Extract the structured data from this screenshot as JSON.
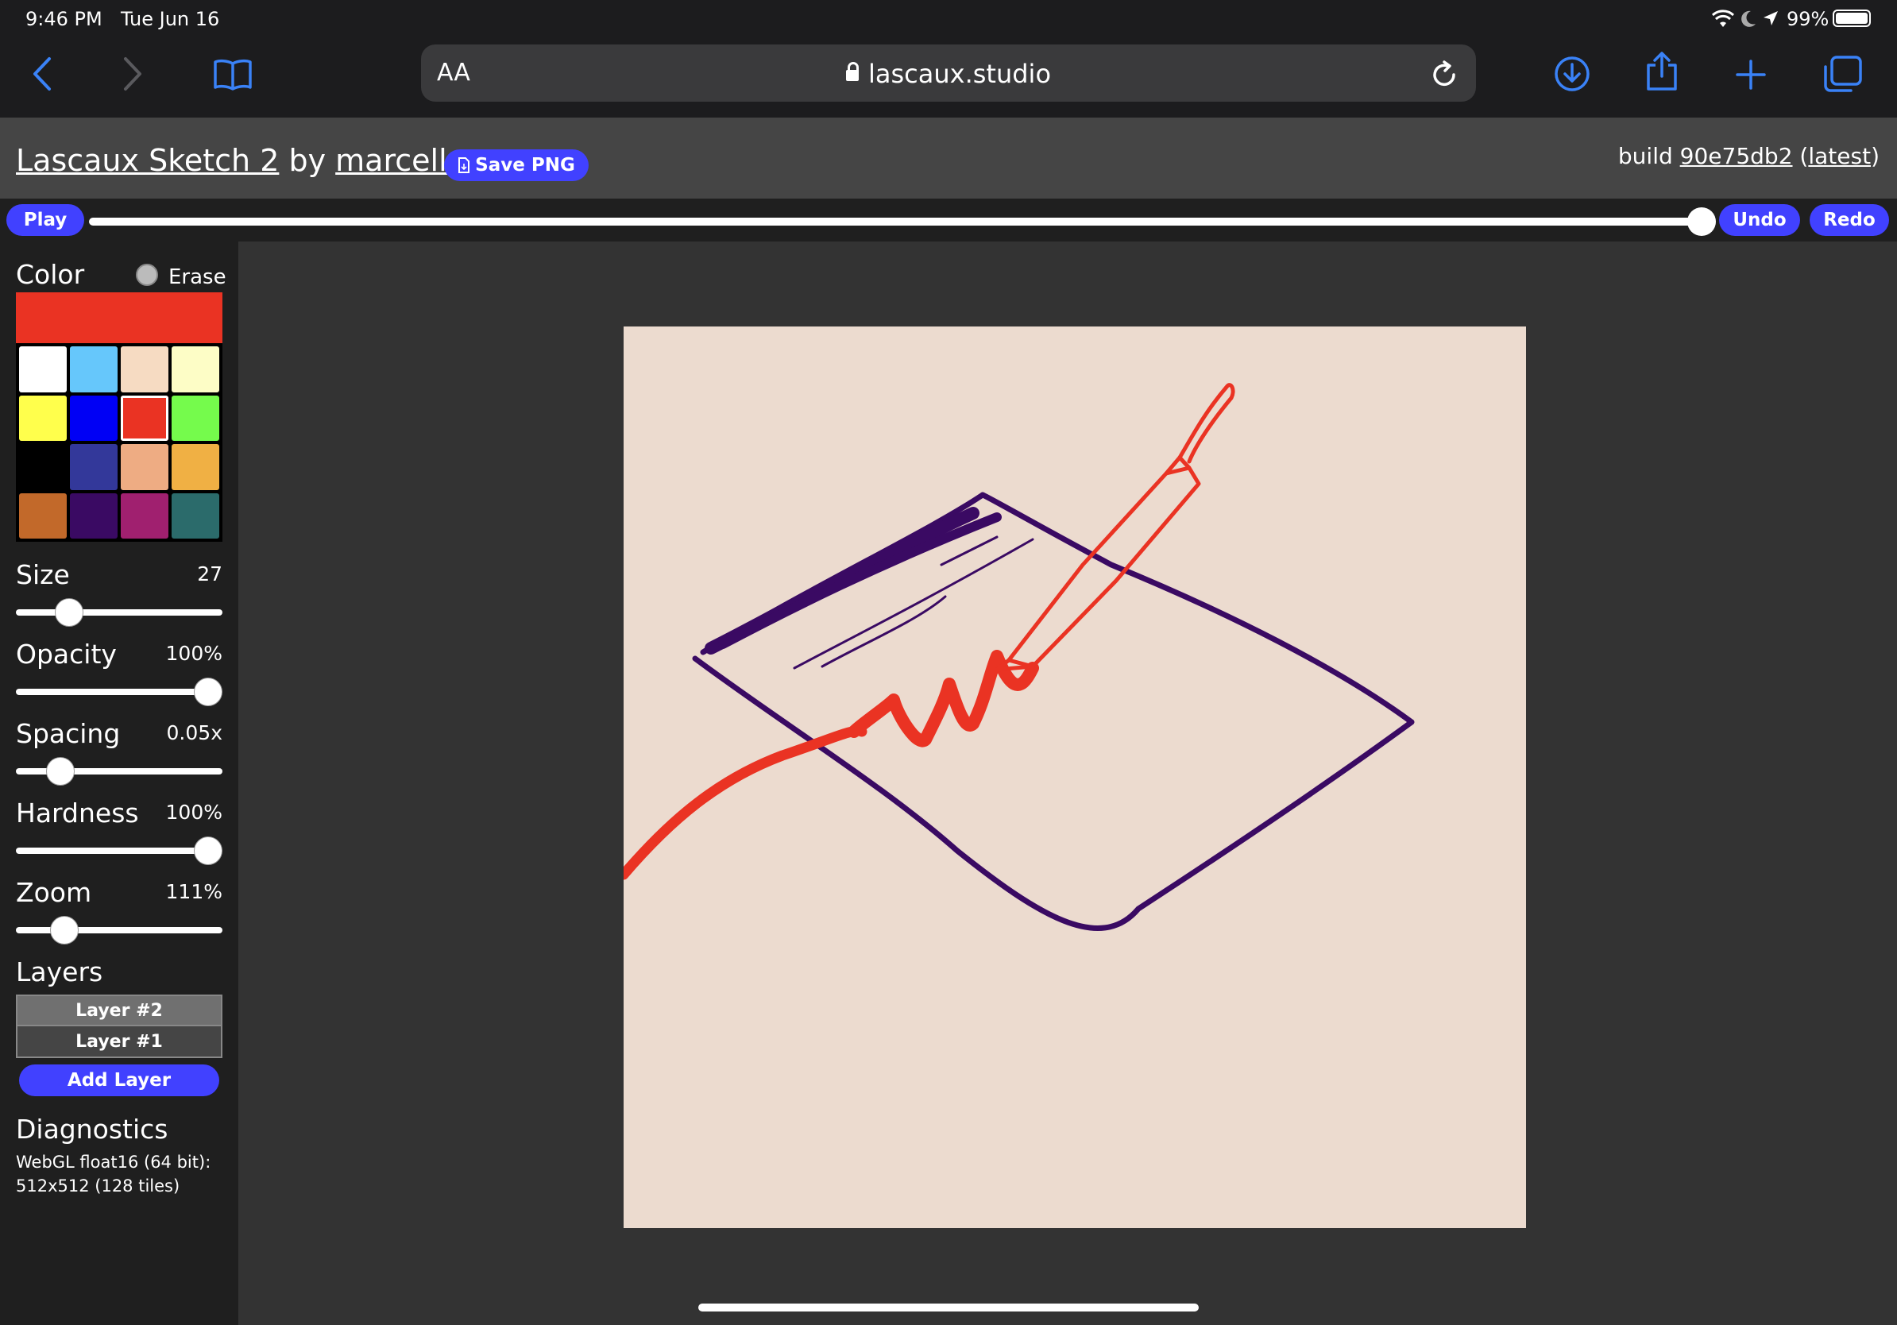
{
  "status_bar": {
    "time": "9:46 PM",
    "date": "Tue Jun 16",
    "battery": "99%"
  },
  "browser": {
    "text_size_label": "AA",
    "url": "lascaux.studio",
    "icons": [
      "back-icon",
      "forward-icon",
      "bookmarks-icon",
      "reload-icon",
      "download-icon",
      "share-icon",
      "new-tab-icon",
      "tabs-icon"
    ]
  },
  "app": {
    "title": "Lascaux Sketch 2",
    "by": " by ",
    "author": "marcello",
    "save_label": "Save PNG",
    "build_prefix": "build ",
    "build_hash": "90e75db2",
    "build_open": " (",
    "build_latest": "latest",
    "build_close": ")"
  },
  "timeline": {
    "play_label": "Play",
    "undo_label": "Undo",
    "redo_label": "Redo",
    "position": 1.0
  },
  "sidebar": {
    "color_label": "Color",
    "erase_label": "Erase",
    "erase_checked": false,
    "current_color": "#ea3323",
    "swatches": [
      "#ffffff",
      "#66c7fb",
      "#f6dbc2",
      "#fdfdc6",
      "#ffff4c",
      "#0000f5",
      "#ea3323",
      "#75fb4c",
      "#000000",
      "#33389a",
      "#eeac83",
      "#f0b044",
      "#c2692a",
      "#3a0a63",
      "#a0206f",
      "#2b6b6b"
    ],
    "selected_swatch": 6,
    "size": {
      "label": "Size",
      "value": "27",
      "fraction": 0.22
    },
    "opacity": {
      "label": "Opacity",
      "value": "100%",
      "fraction": 1.0
    },
    "spacing": {
      "label": "Spacing",
      "value": "0.05x",
      "fraction": 0.17
    },
    "hardness": {
      "label": "Hardness",
      "value": "100%",
      "fraction": 1.0
    },
    "zoom": {
      "label": "Zoom",
      "value": "111%",
      "fraction": 0.19
    },
    "layers_label": "Layers",
    "layers": [
      "Layer #2",
      "Layer #1"
    ],
    "add_layer_label": "Add Layer",
    "diagnostics_label": "Diagnostics",
    "diagnostics_line1": "WebGL float16 (64 bit):",
    "diagnostics_line2": "512x512 (128 tiles)"
  },
  "canvas": {
    "background": "#ecdbcf",
    "stroke_colors": [
      "#3a0a63",
      "#ea3323"
    ]
  }
}
